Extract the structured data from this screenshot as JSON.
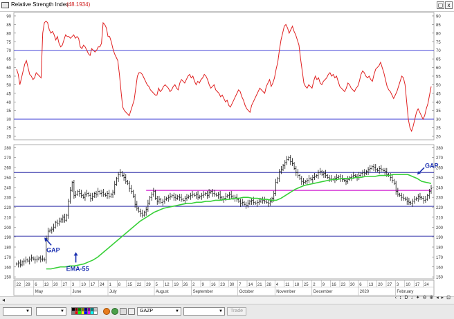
{
  "window": {
    "title": "Relative Strength Index",
    "title_value": "(48.1934)",
    "restore_label": "▢",
    "close_label": "x"
  },
  "rsi_panel": {
    "y_ticks": [
      "90",
      "85",
      "80",
      "75",
      "70",
      "65",
      "60",
      "55",
      "50",
      "45",
      "40",
      "35",
      "30",
      "25",
      "20"
    ],
    "upper_level": 70,
    "lower_level": 30,
    "range": [
      18,
      92
    ],
    "values": [
      59,
      56,
      50,
      54,
      58,
      62,
      64,
      60,
      56,
      55,
      53,
      54,
      57,
      56,
      55,
      54,
      80,
      86,
      87,
      86,
      82,
      80,
      81,
      79,
      76,
      78,
      74,
      72,
      73,
      76,
      79,
      78,
      78,
      77,
      78,
      79,
      77,
      78,
      77,
      72,
      71,
      73,
      72,
      70,
      68,
      67,
      71,
      70,
      69,
      70,
      72,
      72,
      74,
      86,
      85,
      83,
      78,
      78,
      75,
      71,
      68,
      66,
      64,
      56,
      46,
      37,
      35,
      34,
      33,
      32,
      35,
      38,
      41,
      48,
      55,
      57,
      57,
      56,
      54,
      52,
      50,
      49,
      47,
      46,
      45,
      44,
      44,
      48,
      46,
      47,
      49,
      50,
      49,
      48,
      46,
      47,
      49,
      50,
      48,
      47,
      51,
      53,
      52,
      51,
      53,
      55,
      56,
      54,
      55,
      52,
      50,
      52,
      51,
      53,
      54,
      56,
      55,
      53,
      50,
      48,
      49,
      50,
      47,
      46,
      45,
      43,
      44,
      42,
      40,
      41,
      38,
      37,
      39,
      41,
      43,
      45,
      47,
      46,
      43,
      41,
      38,
      36,
      35,
      34,
      38,
      40,
      42,
      44,
      46,
      48,
      47,
      46,
      45,
      49,
      51,
      53,
      49,
      51,
      54,
      59,
      63,
      70,
      76,
      80,
      84,
      85,
      83,
      80,
      82,
      84,
      81,
      79,
      76,
      73,
      65,
      58,
      51,
      49,
      48,
      50,
      49,
      48,
      52,
      55,
      53,
      54,
      51,
      50,
      52,
      53,
      54,
      56,
      57,
      55,
      56,
      54,
      55,
      52,
      49,
      48,
      47,
      46,
      48,
      51,
      50,
      48,
      47,
      46,
      48,
      49,
      52,
      56,
      58,
      57,
      55,
      54,
      55,
      53,
      52,
      56,
      59,
      60,
      61,
      63,
      60,
      57,
      53,
      49,
      47,
      46,
      44,
      42,
      44,
      46,
      49,
      52,
      55,
      54,
      50,
      40,
      30,
      25,
      23,
      26,
      30,
      34,
      36,
      34,
      32,
      30,
      32,
      36,
      39,
      44,
      49
    ]
  },
  "price_panel": {
    "y_ticks": [
      "280",
      "270",
      "260",
      "250",
      "240",
      "230",
      "220",
      "210",
      "200",
      "190",
      "180",
      "170",
      "160",
      "150"
    ],
    "range": [
      148,
      283
    ],
    "blue_lines": [
      255,
      221,
      191
    ],
    "magenta_line": 237,
    "annotations": [
      {
        "label": "GAP",
        "price": 186,
        "bar": 15
      },
      {
        "label": "EMA-55",
        "price": 170,
        "bar": 32
      },
      {
        "label": "GAP",
        "price": 257,
        "bar": 218
      }
    ]
  },
  "x_axis": {
    "day_ticks": [
      "22",
      "29",
      "6",
      "13",
      "20",
      "27",
      "3",
      "10",
      "17",
      "24",
      "1",
      "8",
      "15",
      "22",
      "29",
      "5",
      "12",
      "19",
      "26",
      "2",
      "9",
      "16",
      "23",
      "30",
      "7",
      "14",
      "21",
      "28",
      "4",
      "11",
      "18",
      "25",
      "2",
      "9",
      "16",
      "23",
      "30",
      "6",
      "13",
      "20",
      "27",
      "3",
      "10",
      "17",
      "24"
    ],
    "month_labels": [
      "May",
      "June",
      "July",
      "August",
      "September",
      "October",
      "November",
      "December",
      "2020",
      "February"
    ]
  },
  "chart_data": {
    "type": "line",
    "title": "Relative Strength Index",
    "series": [
      {
        "name": "RSI",
        "color": "#e02020"
      },
      {
        "name": "Close",
        "color": "#000000"
      },
      {
        "name": "EMA-55",
        "color": "#2ecc2e"
      }
    ],
    "closes": [
      163,
      164,
      162,
      165,
      166,
      167,
      166,
      168,
      169,
      168,
      167,
      168,
      169,
      168,
      168,
      167,
      189,
      196,
      197,
      198,
      200,
      205,
      204,
      206,
      208,
      210,
      207,
      212,
      226,
      237,
      245,
      232,
      233,
      236,
      234,
      232,
      230,
      233,
      234,
      232,
      229,
      231,
      234,
      233,
      236,
      234,
      235,
      233,
      232,
      234,
      231,
      233,
      235,
      243,
      249,
      253,
      255,
      252,
      250,
      246,
      244,
      239,
      236,
      231,
      223,
      219,
      216,
      214,
      212,
      215,
      218,
      224,
      230,
      233,
      236,
      229,
      226,
      228,
      225,
      226,
      228,
      229,
      230,
      231,
      232,
      230,
      229,
      231,
      230,
      228,
      227,
      229,
      230,
      231,
      232,
      233,
      232,
      233,
      230,
      231,
      232,
      233,
      234,
      232,
      235,
      236,
      234,
      233,
      232,
      233,
      230,
      228,
      229,
      231,
      232,
      233,
      231,
      229,
      230,
      228,
      226,
      224,
      225,
      223,
      222,
      224,
      226,
      227,
      225,
      224,
      225,
      226,
      228,
      227,
      226,
      225,
      224,
      226,
      229,
      234,
      245,
      249,
      256,
      258,
      262,
      265,
      268,
      270,
      266,
      264,
      259,
      255,
      252,
      249,
      246,
      245,
      246,
      247,
      249,
      248,
      250,
      251,
      252,
      255,
      256,
      253,
      254,
      252,
      250,
      249,
      248,
      248,
      249,
      250,
      251,
      249,
      248,
      247,
      246,
      248,
      250,
      251,
      252,
      251,
      250,
      252,
      254,
      255,
      254,
      256,
      258,
      259,
      261,
      260,
      258,
      257,
      259,
      258,
      257,
      256,
      253,
      252,
      250,
      247,
      244,
      236,
      233,
      232,
      230,
      229,
      228,
      226,
      225,
      224,
      226,
      228,
      229,
      231,
      230,
      229,
      227,
      228,
      232,
      236,
      239
    ],
    "ema": [
      158,
      158,
      159,
      160,
      160,
      161,
      161,
      162,
      163,
      165,
      167,
      170,
      174,
      178,
      182,
      186,
      190,
      194,
      198,
      202,
      206,
      209,
      212,
      215,
      217,
      219,
      220,
      221,
      222,
      223,
      224,
      224,
      225,
      225,
      226,
      226,
      227,
      227,
      228,
      228,
      229,
      229,
      230,
      230,
      229,
      229,
      228,
      228,
      227,
      227,
      229,
      232,
      235,
      238,
      240,
      242,
      243,
      244,
      245,
      246,
      247,
      248,
      248,
      249,
      249,
      249,
      250,
      250,
      251,
      251,
      251,
      252,
      252,
      252,
      253,
      253,
      253,
      253,
      251,
      249,
      246,
      245,
      244
    ],
    "ema_start_bar": 16
  }
}
